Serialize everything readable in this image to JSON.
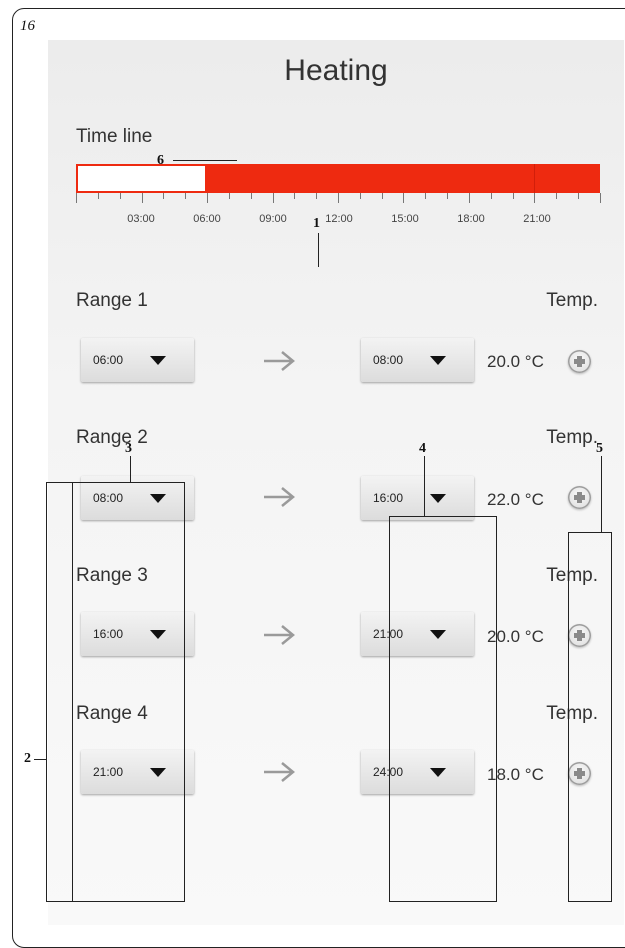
{
  "page": {
    "number": "16"
  },
  "screen": {
    "title": "Heating"
  },
  "timeline": {
    "label": "Time line",
    "active_from": "06:00",
    "active_until": "24:00",
    "ticks": [
      "03:00",
      "06:00",
      "09:00",
      "12:00",
      "15:00",
      "18:00",
      "21:00"
    ],
    "colors": {
      "active": "#ee2a10",
      "inactive": "#ffffff"
    }
  },
  "ranges": [
    {
      "label": "Range 1",
      "temp_heading": "Temp.",
      "from": "06:00",
      "to": "08:00",
      "temp": "20.0 °C"
    },
    {
      "label": "Range 2",
      "temp_heading": "Temp.",
      "from": "08:00",
      "to": "16:00",
      "temp": "22.0 °C"
    },
    {
      "label": "Range 3",
      "temp_heading": "Temp.",
      "from": "16:00",
      "to": "21:00",
      "temp": "20.0 °C"
    },
    {
      "label": "Range 4",
      "temp_heading": "Temp.",
      "from": "21:00",
      "to": "24:00",
      "temp": "18.0 °C"
    }
  ],
  "icons": {
    "arrow": "arrow-right-icon",
    "add": "plus-icon",
    "dropdown": "caret-down-icon"
  },
  "callouts": [
    "1",
    "2",
    "3",
    "4",
    "5",
    "6"
  ]
}
